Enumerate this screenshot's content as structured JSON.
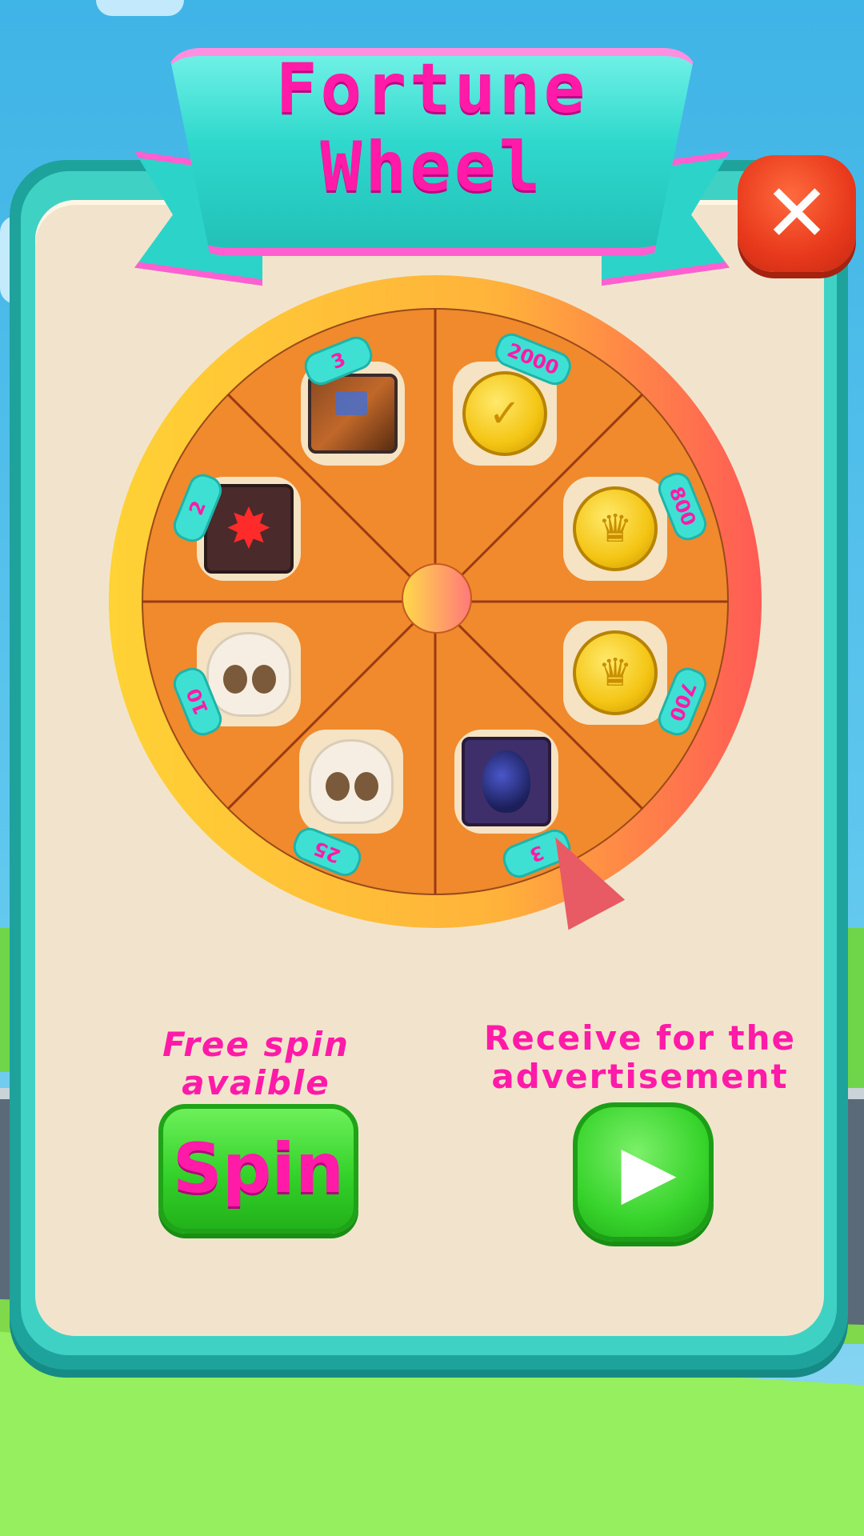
{
  "header": {
    "title_line1": "Fortune",
    "title_line2": "Wheel"
  },
  "close": {
    "icon": "close-icon",
    "glyph": "✕",
    "color": "#e8391c"
  },
  "wheel": {
    "segments": [
      {
        "id": "book",
        "amount": "3",
        "icon": "spellbook-icon"
      },
      {
        "id": "coins-2000",
        "amount": "2000",
        "icon": "gold-coin-icon"
      },
      {
        "id": "coins-800",
        "amount": "800",
        "icon": "gold-coin-icon"
      },
      {
        "id": "coins-700",
        "amount": "700",
        "icon": "gold-coin-icon"
      },
      {
        "id": "egg",
        "amount": "3",
        "icon": "egg-icon"
      },
      {
        "id": "skull-25",
        "amount": "25",
        "icon": "skull-icon"
      },
      {
        "id": "skull-10",
        "amount": "10",
        "icon": "skull-icon"
      },
      {
        "id": "badge",
        "amount": "2",
        "icon": "star-badge-icon"
      }
    ],
    "colors": {
      "slice": "#f08a2c",
      "rim_start": "#ffd235",
      "rim_end": "#ff5a55"
    }
  },
  "actions": {
    "free_spin_text": "Free spin avaible",
    "spin_label": "Spin",
    "ad_text": "Receive for the advertisement",
    "play_glyph": "▶"
  },
  "accent": "#ff1aa8"
}
